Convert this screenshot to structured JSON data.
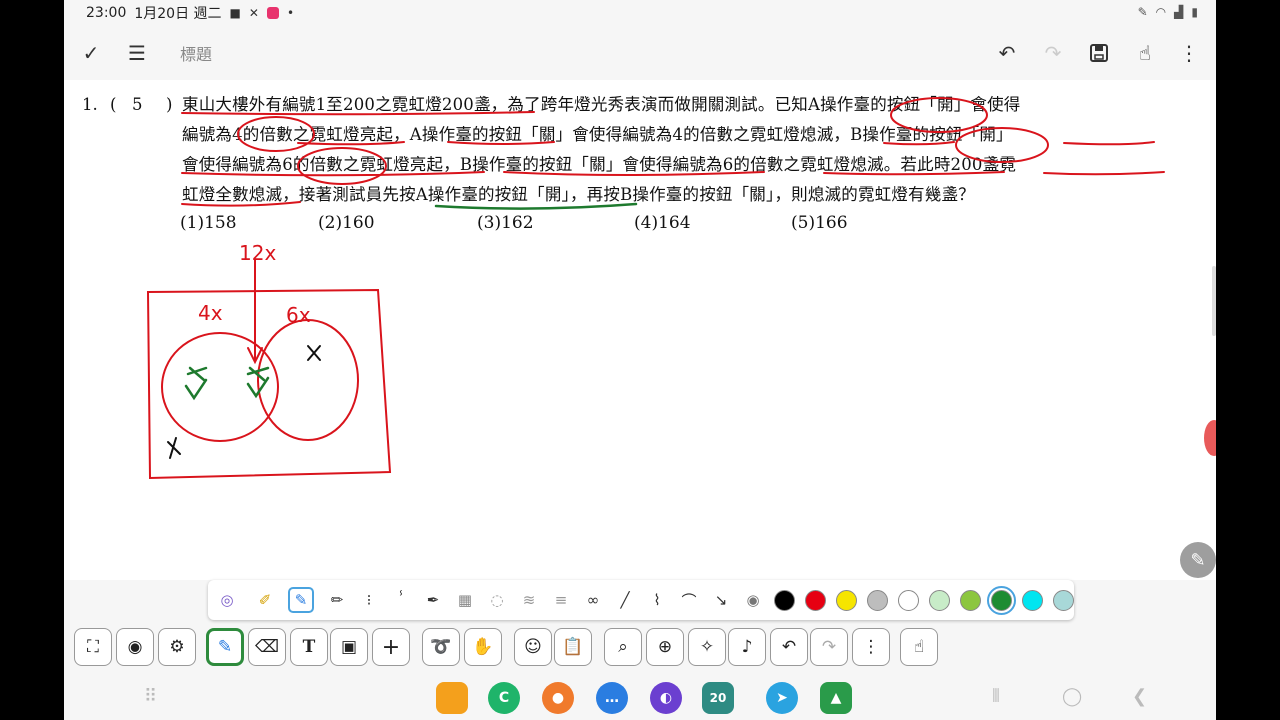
{
  "status_bar": {
    "time": "23:00",
    "date": "1月20日 週二",
    "icons": [
      "camera-icon",
      "tools-icon",
      "app-badge-icon",
      "dot-icon"
    ],
    "right_icons": [
      "pen-icon",
      "wifi-icon",
      "signal-icon",
      "battery-icon"
    ]
  },
  "toolbar": {
    "title_placeholder": "標題",
    "left_icons": [
      "check-icon",
      "menu-icon"
    ],
    "right_icons": [
      "undo-icon",
      "redo-icon",
      "save-icon",
      "touch-pen-icon",
      "more-icon"
    ]
  },
  "question": {
    "number": "1.",
    "paren_open": "(",
    "answer": "5",
    "paren_close": ")",
    "lines": [
      "東山大樓外有編號1至200之霓虹燈200盞，為了跨年燈光秀表演而做開關測試。已知A操作臺的按鈕「開」會使得",
      "編號為4的倍數之霓虹燈亮起，A操作臺的按鈕「關」會使得編號為4的倍數之霓虹燈熄滅，B操作臺的按鈕「開」",
      "會使得編號為6的倍數之霓虹燈亮起，B操作臺的按鈕「關」會使得編號為6的倍數之霓虹燈熄滅。若此時200盞霓",
      "虹燈全數熄滅，接著測試員先按A操作臺的按鈕「開」，再按B操作臺的按鈕「關」，則熄滅的霓虹燈有幾盞？"
    ],
    "options": [
      "(1)158",
      "(2)160",
      "(3)162",
      "(4)164",
      "(5)166"
    ]
  },
  "handwriting": {
    "top_label": "12x",
    "left_label": "4x",
    "right_label": "6x",
    "colors": {
      "red": "#d9141c",
      "green": "#1e7a2e",
      "black": "#111111"
    }
  },
  "pen_palette": {
    "tools": [
      "pen-style-icon",
      "pen-case-icon",
      "pen-active-icon",
      "marker-icon",
      "dotted-pen-icon",
      "brush-icon",
      "fountain-pen-icon",
      "texture-dots-icon",
      "texture-spray-icon",
      "texture-soft-icon",
      "texture-lines-icon",
      "texture-blob-icon",
      "line-icon",
      "zigzag-icon",
      "arc-icon",
      "arrow-icon",
      "color-wheel-icon"
    ],
    "colors": [
      "#000000",
      "#e60012",
      "#f6e500",
      "#bdbdbd",
      "#ffffff",
      "#c8ecc8",
      "#8cc63f",
      "#1e8c32",
      "#00e5f0",
      "#a8d8d8"
    ],
    "selected_color": "#1e8c32"
  },
  "bottom_tools": [
    "fullscreen-icon",
    "eye-icon",
    "settings-doc-icon",
    "pen-tool-icon",
    "eraser-icon",
    "text-icon",
    "image-icon",
    "add-icon",
    "lasso-icon",
    "hand-icon",
    "emoji-icon",
    "clipboard-icon",
    "search-doc-icon",
    "zoom-icon",
    "highlighter-icon",
    "music-icon",
    "undo-icon",
    "redo-icon",
    "more-icon",
    "touch-icon"
  ],
  "text_tool_label": "T",
  "add_tool_label": "+",
  "nav_bar": {
    "apps": [
      {
        "name": "files-app-icon",
        "color": "#f4a01c",
        "label": ""
      },
      {
        "name": "c-app-icon",
        "color": "#1fb46a",
        "label": "C"
      },
      {
        "name": "contacts-app-icon",
        "color": "#f07a2c",
        "label": ""
      },
      {
        "name": "messages-app-icon",
        "color": "#2a7de1",
        "label": ""
      },
      {
        "name": "browser-app-icon",
        "color": "#6b3fd0",
        "label": ""
      },
      {
        "name": "calendar-app-icon",
        "color": "#2e8b83",
        "label": "20"
      },
      {
        "name": "telegram-app-icon",
        "color": "#2aa3e0",
        "label": ""
      },
      {
        "name": "stock-app-icon",
        "color": "#2a9b4a",
        "label": ""
      }
    ]
  }
}
